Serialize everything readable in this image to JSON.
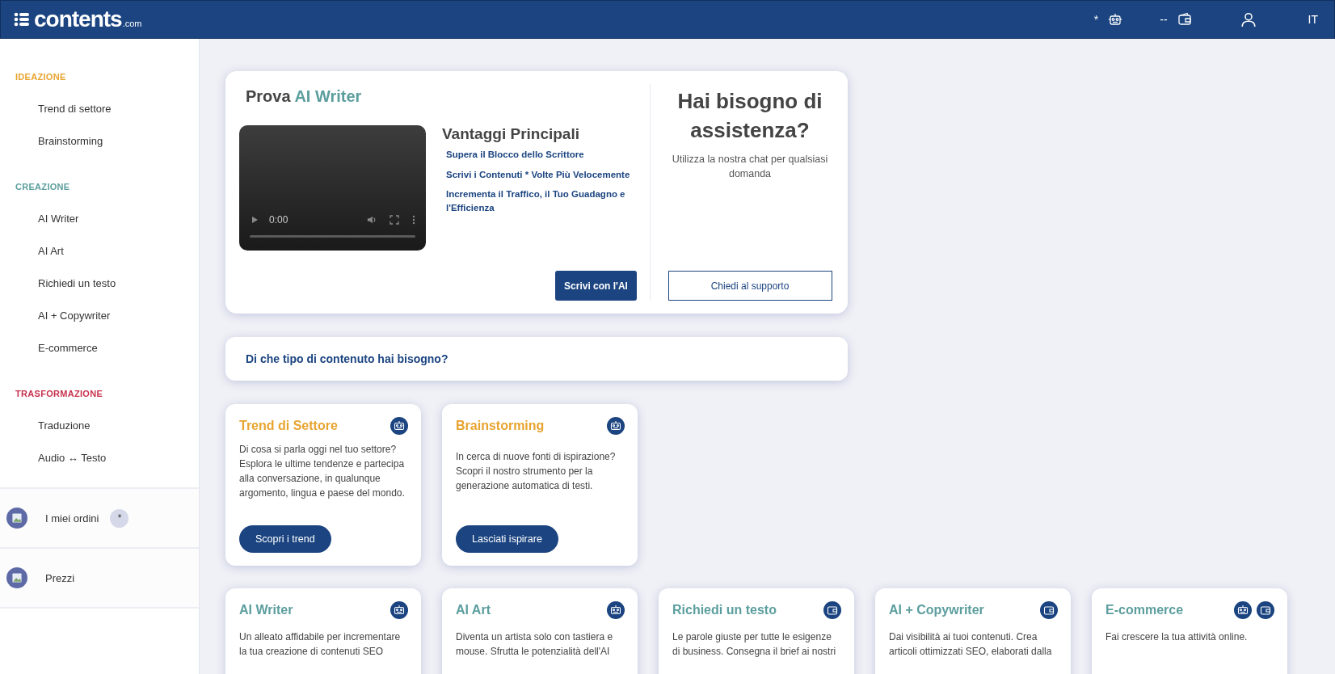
{
  "header": {
    "logo": "contents",
    "logo_suffix": ".com",
    "credits": [
      {
        "value": "*",
        "kind": "robot"
      },
      {
        "value": "--",
        "kind": "wallet"
      }
    ],
    "language": "IT"
  },
  "sidebar": {
    "sections": [
      {
        "title": "IDEAZIONE",
        "color": "#e8a430",
        "items": [
          "Trend di settore",
          "Brainstorming"
        ]
      },
      {
        "title": "CREAZIONE",
        "color": "#5c9e9e",
        "items": [
          "AI Writer",
          "AI Art",
          "Richiedi un testo",
          "AI + Copywriter",
          "E-commerce"
        ]
      },
      {
        "title": "TRASFORMAZIONE",
        "color": "#c8324e",
        "items": [
          "Traduzione",
          "Audio ↔ Testo"
        ]
      }
    ],
    "links": [
      {
        "label": "I miei ordini",
        "badge": "*"
      },
      {
        "label": "Prezzi"
      }
    ]
  },
  "promo": {
    "title_prefix": "Prova",
    "title_highlight": "AI Writer",
    "video": {
      "time": "0:00",
      "level": 0
    },
    "benefits_title": "Vantaggi Principali",
    "benefits": [
      "Supera il Blocco dello Scrittore",
      "Scrivi i Contenuti * Volte Più Velocemente",
      "Incrementa il Traffico, il Tuo Guadagno e l'Efficienza"
    ],
    "button": "Scrivi con l'AI"
  },
  "support": {
    "title": "Hai bisogno di assistenza?",
    "text": "Utilizza la nostra chat per qualsiasi domanda",
    "button": "Chiedi al supporto"
  },
  "question": "Di che tipo di contenuto hai bisogno?",
  "ideation_cards": [
    {
      "title": "Trend di Settore",
      "color": "#e8a430",
      "icons": [
        {
          "kind": "robot"
        }
      ],
      "text": "Di cosa si parla oggi nel tuo settore? Esplora le ultime tendenze e partecipa alla conversazione, in qualunque argomento, lingua e paese del mondo.",
      "button": "Scopri i trend"
    },
    {
      "title": "Brainstorming",
      "color": "#e8a430",
      "icons": [
        {
          "kind": "robot"
        }
      ],
      "text": "In cerca di nuove fonti di ispirazione? Scopri il nostro strumento per la generazione automatica di testi.",
      "button": "Lasciati ispirare"
    }
  ],
  "creation_cards": [
    {
      "title": "AI Writer",
      "color": "#5c9e9e",
      "icons": [
        {
          "kind": "robot"
        }
      ],
      "text": "Un alleato affidabile per incrementare la tua creazione di contenuti SEO"
    },
    {
      "title": "AI Art",
      "color": "#5c9e9e",
      "icons": [
        {
          "kind": "robot"
        }
      ],
      "text": "Diventa un artista solo con tastiera e mouse. Sfrutta le potenzialità dell'AI"
    },
    {
      "title": "Richiedi un testo",
      "color": "#5c9e9e",
      "icons": [
        {
          "kind": "wallet"
        }
      ],
      "text": "Le parole giuste per tutte le esigenze di business. Consegna il brief ai nostri"
    },
    {
      "title": "AI + Copywriter",
      "color": "#5c9e9e",
      "icons": [
        {
          "kind": "wallet"
        }
      ],
      "text": "Dai visibilità ai tuoi contenuti. Crea articoli ottimizzati SEO, elaborati dalla"
    },
    {
      "title": "E-commerce",
      "color": "#5c9e9e",
      "icons": [
        {
          "kind": "robot"
        },
        {
          "kind": "wallet"
        }
      ],
      "text": "Fai crescere la tua attività online."
    }
  ]
}
